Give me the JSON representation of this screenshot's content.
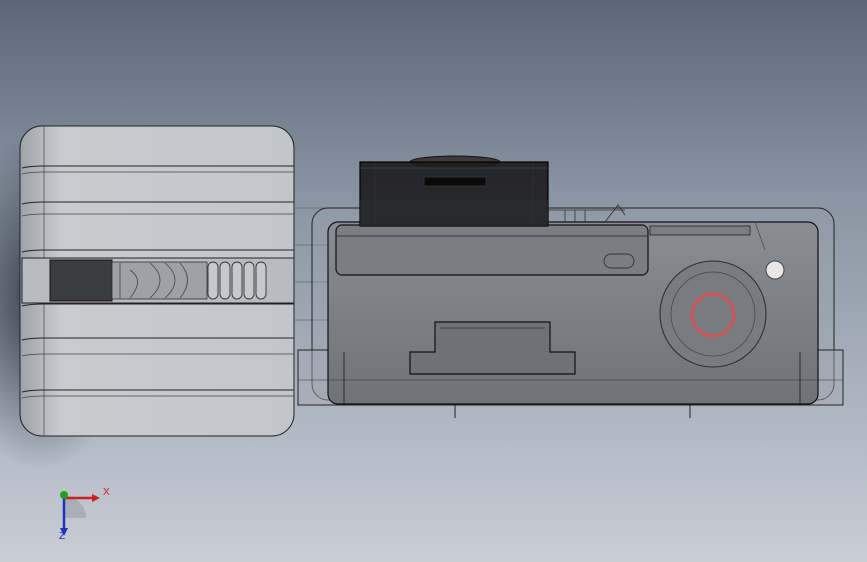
{
  "viewport": {
    "background_top": "#5c6675",
    "background_bottom": "#c9ced5"
  },
  "model": {
    "body_color": "#7d8085",
    "lens_cap_color": "#1a1a1a",
    "shutter_ring_color": "#cc5555",
    "edge_color": "#1c1c1c"
  },
  "triad": {
    "x_label": "X",
    "z_label": "Z",
    "x_color": "#cc2020",
    "y_color": "#20a020",
    "z_color": "#2030c0"
  }
}
